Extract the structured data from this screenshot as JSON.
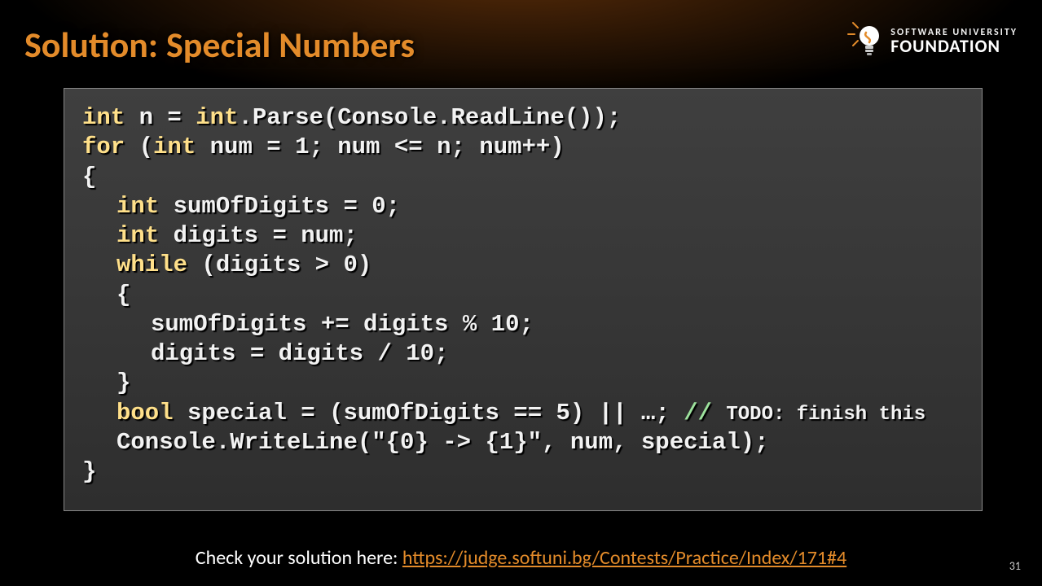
{
  "slide": {
    "title": "Solution: Special Numbers",
    "page_number": "31"
  },
  "logo": {
    "line1": "SOFTWARE UNIVERSITY",
    "line2": "FOUNDATION"
  },
  "code": {
    "l1_a": "int",
    "l1_b": " n = ",
    "l1_c": "int",
    "l1_d": ".Parse(Console.ReadLine());",
    "l2_a": "for ",
    "l2_b": "(",
    "l2_c": "int",
    "l2_d": " num = 1; num <= n; num++)",
    "l3": "{",
    "l4_a": "int",
    "l4_b": " sumOfDigits = 0;",
    "l5_a": "int",
    "l5_b": " digits = num;",
    "l6_a": "while ",
    "l6_b": "(digits > 0)",
    "l7": "{",
    "l8": "sumOfDigits += digits % 10;",
    "l9": "digits = digits / 10;",
    "l10": "}",
    "l11_a": "bool",
    "l11_b": " special = (sumOfDigits == 5) || …; ",
    "l11_c": "// ",
    "l11_d": "TODO: finish this",
    "l12": "Console.WriteLine(\"{0} -> {1}\", num, special);",
    "l13": "}"
  },
  "footer": {
    "text": "Check your solution here: ",
    "link_text": "https://judge.softuni.bg/Contests/Practice/Index/171#4",
    "link_href": "https://judge.softuni.bg/Contests/Practice/Index/171#4"
  }
}
